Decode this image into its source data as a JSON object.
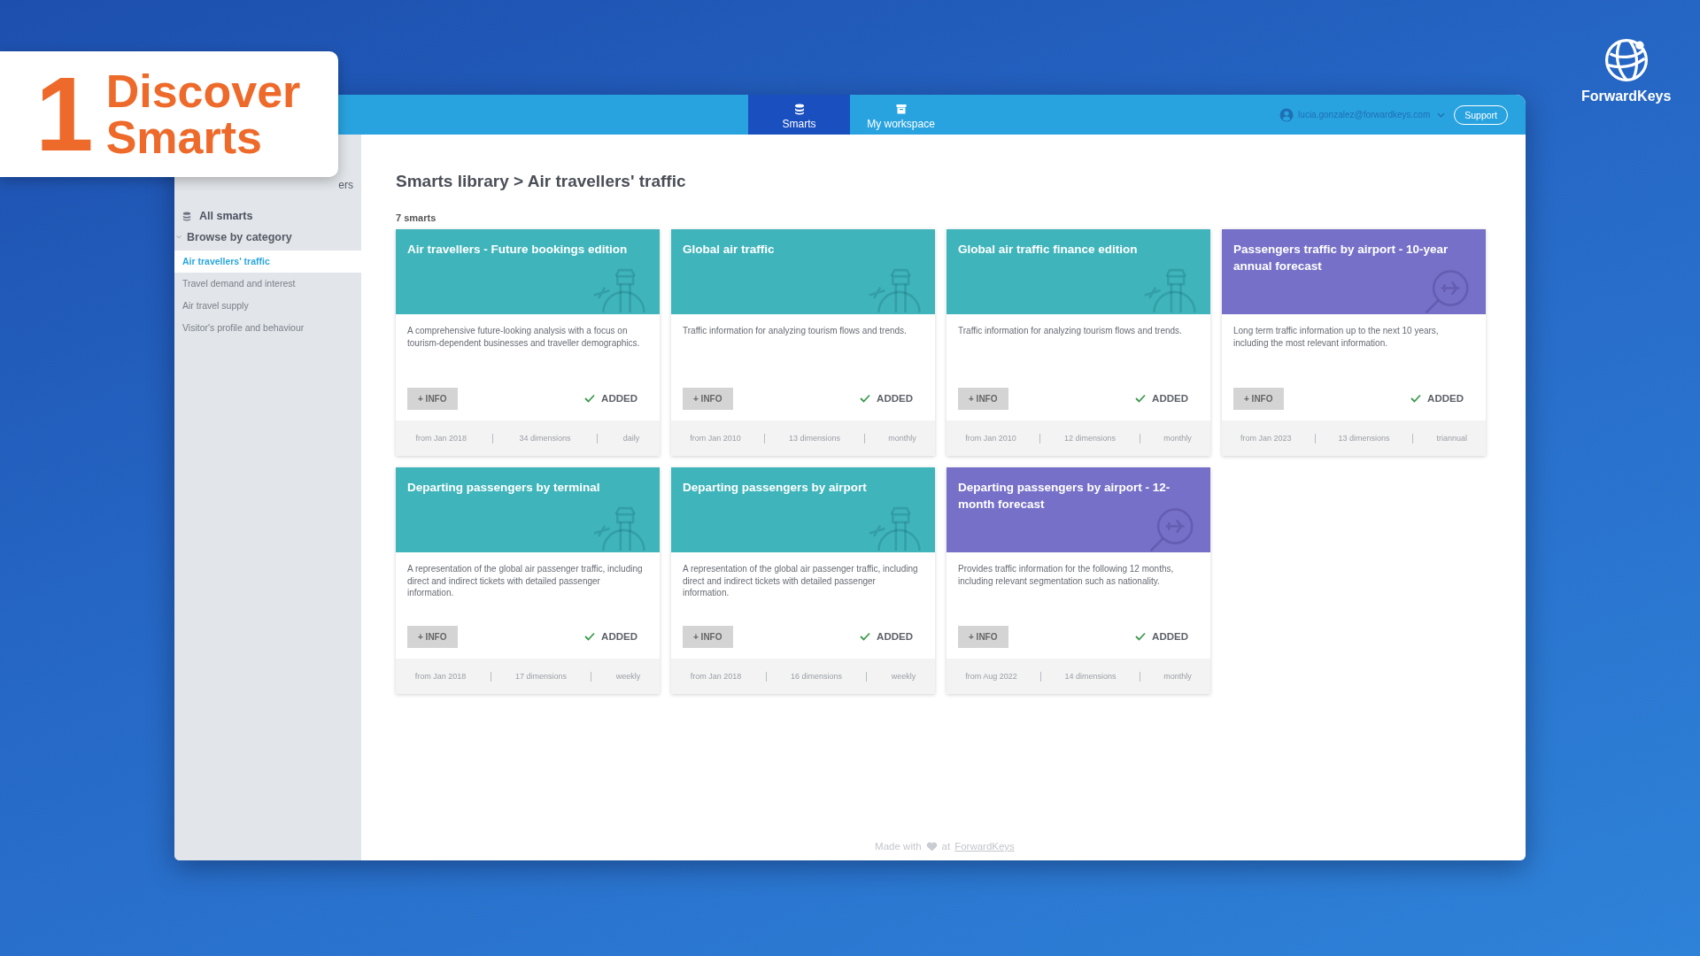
{
  "overlay": {
    "number": "1",
    "title": "Discover Smarts"
  },
  "brand": {
    "name": "ForwardKeys"
  },
  "topbar": {
    "tabs": [
      {
        "label": "Smarts",
        "kind": "stack",
        "selected": true
      },
      {
        "label": "My workspace",
        "kind": "archive",
        "selected": false
      }
    ],
    "user": "lucia.gonzalez@forwardkeys.com",
    "support": "Support"
  },
  "sidebar": {
    "partial_heading": "ers",
    "all_smarts": "All smarts",
    "section": {
      "label": "Browse by category",
      "expanded": true
    },
    "items": [
      {
        "label": "Air travellers' traffic",
        "selected": true
      },
      {
        "label": "Travel demand and interest",
        "selected": false
      },
      {
        "label": "Air travel supply",
        "selected": false
      },
      {
        "label": "Visitor's profile and behaviour",
        "selected": false
      }
    ]
  },
  "main": {
    "breadcrumb": "Smarts library > Air travellers' traffic",
    "count": "7 smarts",
    "cards": [
      {
        "title": "Air travellers - Future bookings edition",
        "kind": "tower",
        "color": "#3fb5bb",
        "description": "A comprehensive future-looking analysis with a focus on tourism-dependent businesses and traveller demographics.",
        "info": "+ INFO",
        "added": true,
        "status": "ADDED",
        "since": "from Jan 2018",
        "dimensions": "34 dimensions",
        "frequency": "daily"
      },
      {
        "title": "Global air traffic",
        "kind": "tower",
        "color": "#3fb5bb",
        "description": "Traffic information for analyzing tourism flows and trends.",
        "info": "+ INFO",
        "added": true,
        "status": "ADDED",
        "since": "from Jan 2010",
        "dimensions": "13 dimensions",
        "frequency": "monthly"
      },
      {
        "title": "Global air traffic finance edition",
        "kind": "tower",
        "color": "#3fb5bb",
        "description": "Traffic information for analyzing tourism flows and trends.",
        "info": "+ INFO",
        "added": true,
        "status": "ADDED",
        "since": "from Jan 2010",
        "dimensions": "12 dimensions",
        "frequency": "monthly"
      },
      {
        "title": "Passengers traffic by airport - 10-year annual forecast",
        "kind": "forecast",
        "color": "#7670c8",
        "description": "Long term traffic information up to the next 10 years, including the most relevant information.",
        "info": "+ INFO",
        "added": true,
        "status": "ADDED",
        "since": "from Jan 2023",
        "dimensions": "13 dimensions",
        "frequency": "triannual"
      },
      {
        "title": "Departing passengers by terminal",
        "kind": "tower",
        "color": "#3fb5bb",
        "description": "A representation of the global air passenger traffic, including direct and indirect tickets with detailed passenger information.",
        "info": "+ INFO",
        "added": true,
        "status": "ADDED",
        "since": "from Jan 2018",
        "dimensions": "17 dimensions",
        "frequency": "weekly"
      },
      {
        "title": "Departing passengers by airport",
        "kind": "tower",
        "color": "#3fb5bb",
        "description": "A representation of the global air passenger traffic, including direct and indirect tickets with detailed passenger information.",
        "info": "+ INFO",
        "added": true,
        "status": "ADDED",
        "since": "from Jan 2018",
        "dimensions": "16 dimensions",
        "frequency": "weekly"
      },
      {
        "title": "Departing passengers by airport - 12-month forecast",
        "kind": "forecast",
        "color": "#7670c8",
        "description": "Provides traffic information for the following 12 months, including relevant segmentation such as nationality.",
        "info": "+ INFO",
        "added": true,
        "status": "ADDED",
        "since": "from Aug 2022",
        "dimensions": "14 dimensions",
        "frequency": "monthly"
      }
    ],
    "footer": {
      "before": "Made with",
      "middle": "at",
      "link": "ForwardKeys"
    }
  }
}
